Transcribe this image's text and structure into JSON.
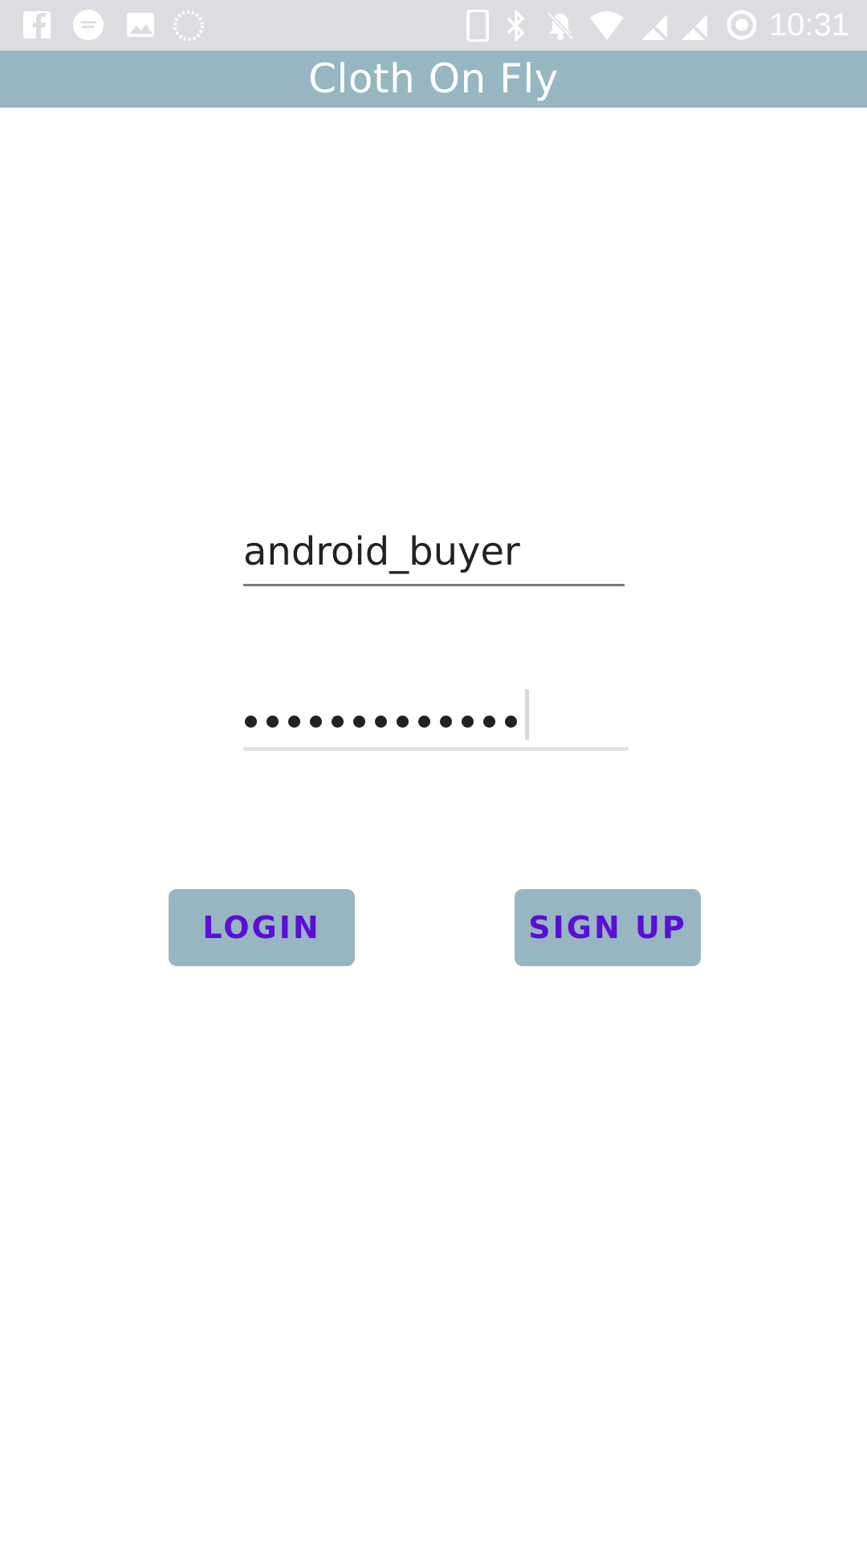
{
  "status_bar": {
    "time": "10:31",
    "left_icons": [
      "facebook-icon",
      "finish-line-icon",
      "image-icon",
      "loading-icon"
    ],
    "right_icons": [
      "phone-icon",
      "bluetooth-icon",
      "mute-icon",
      "wifi-icon",
      "no-sim-icon",
      "no-sim-2-icon",
      "battery-icon"
    ]
  },
  "app_bar": {
    "title": "Cloth On Fly"
  },
  "login_form": {
    "username_value": "android_buyer",
    "password_length": 13
  },
  "buttons": {
    "login_label": "LOGIN",
    "signup_label": "SIGN UP"
  },
  "colors": {
    "app_bar": "#97b6c1",
    "button_bg": "#97b6c1",
    "button_text": "#5a0ed8",
    "status_bar": "#dcdde0"
  }
}
